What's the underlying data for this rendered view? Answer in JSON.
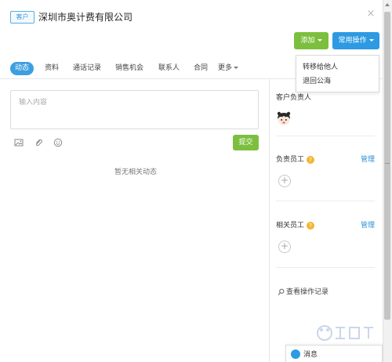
{
  "header": {
    "tag": "客户",
    "company_name": "深圳市奥计费有限公司",
    "close_glyph": "×",
    "add_button": "添加",
    "common_ops_button": "常用操作"
  },
  "dropdown": {
    "items": [
      "转移给他人",
      "退回公海"
    ]
  },
  "tabs": [
    {
      "label": "动态",
      "active": true
    },
    {
      "label": "资料",
      "active": false
    },
    {
      "label": "通话记录",
      "active": false
    },
    {
      "label": "销售机会",
      "active": false
    },
    {
      "label": "联系人",
      "active": false
    },
    {
      "label": "合同",
      "active": false
    },
    {
      "label": "更多",
      "active": false
    }
  ],
  "composer": {
    "placeholder": "输入内容",
    "submit": "提交",
    "tools": [
      "image-icon",
      "attachment-icon",
      "emoji-icon"
    ]
  },
  "feed": {
    "empty_text": "暂无相关动态"
  },
  "sidebar": {
    "owner_title": "客户负责人",
    "responsible_title": "负责员工",
    "responsible_manage": "管理",
    "related_title": "相关员工",
    "related_manage": "管理",
    "log_link": "查看操作记录",
    "help_glyph": "?"
  },
  "chat": {
    "label": "消息"
  },
  "colors": {
    "primary_blue": "#2d9ae2",
    "green": "#7cbf3e",
    "help_orange": "#f2b634"
  }
}
